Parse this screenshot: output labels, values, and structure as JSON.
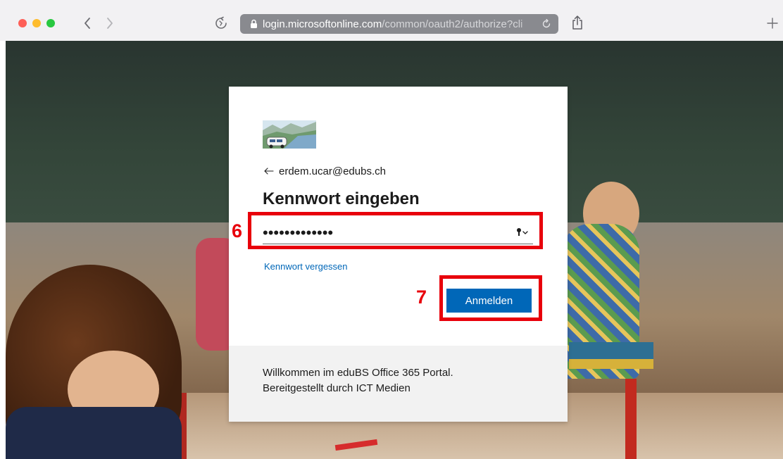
{
  "browser": {
    "url_host": "login.microsoftonline.com",
    "url_path": "/common/oauth2/authorize?cli",
    "icons": {
      "close": "traffic-light-red",
      "minimize": "traffic-light-yellow",
      "zoom": "traffic-light-green",
      "back": "chevron-left-icon",
      "forward": "chevron-right-icon",
      "privacy_report": "privacy-report-icon",
      "lock": "lock-icon",
      "reload": "reload-icon",
      "share": "share-icon",
      "new_tab": "plus-icon"
    }
  },
  "signin": {
    "identity": "erdem.ucar@edubs.ch",
    "title": "Kennwort eingeben",
    "password_value": "•••••••••••••",
    "forgot_link": "Kennwort vergessen",
    "submit_label": "Anmelden",
    "footer_lines": [
      "Willkommen im eduBS Office 365 Portal.",
      "Bereitgestellt durch ICT Medien"
    ]
  },
  "annotations": {
    "step_password": "6",
    "step_submit": "7"
  },
  "colors": {
    "accent": "#0067b8",
    "annotation": "#e8000b",
    "footer_bg": "#f2f2f2",
    "browser_chrome": "#f2f1f3",
    "url_bar": "#898a8f"
  }
}
